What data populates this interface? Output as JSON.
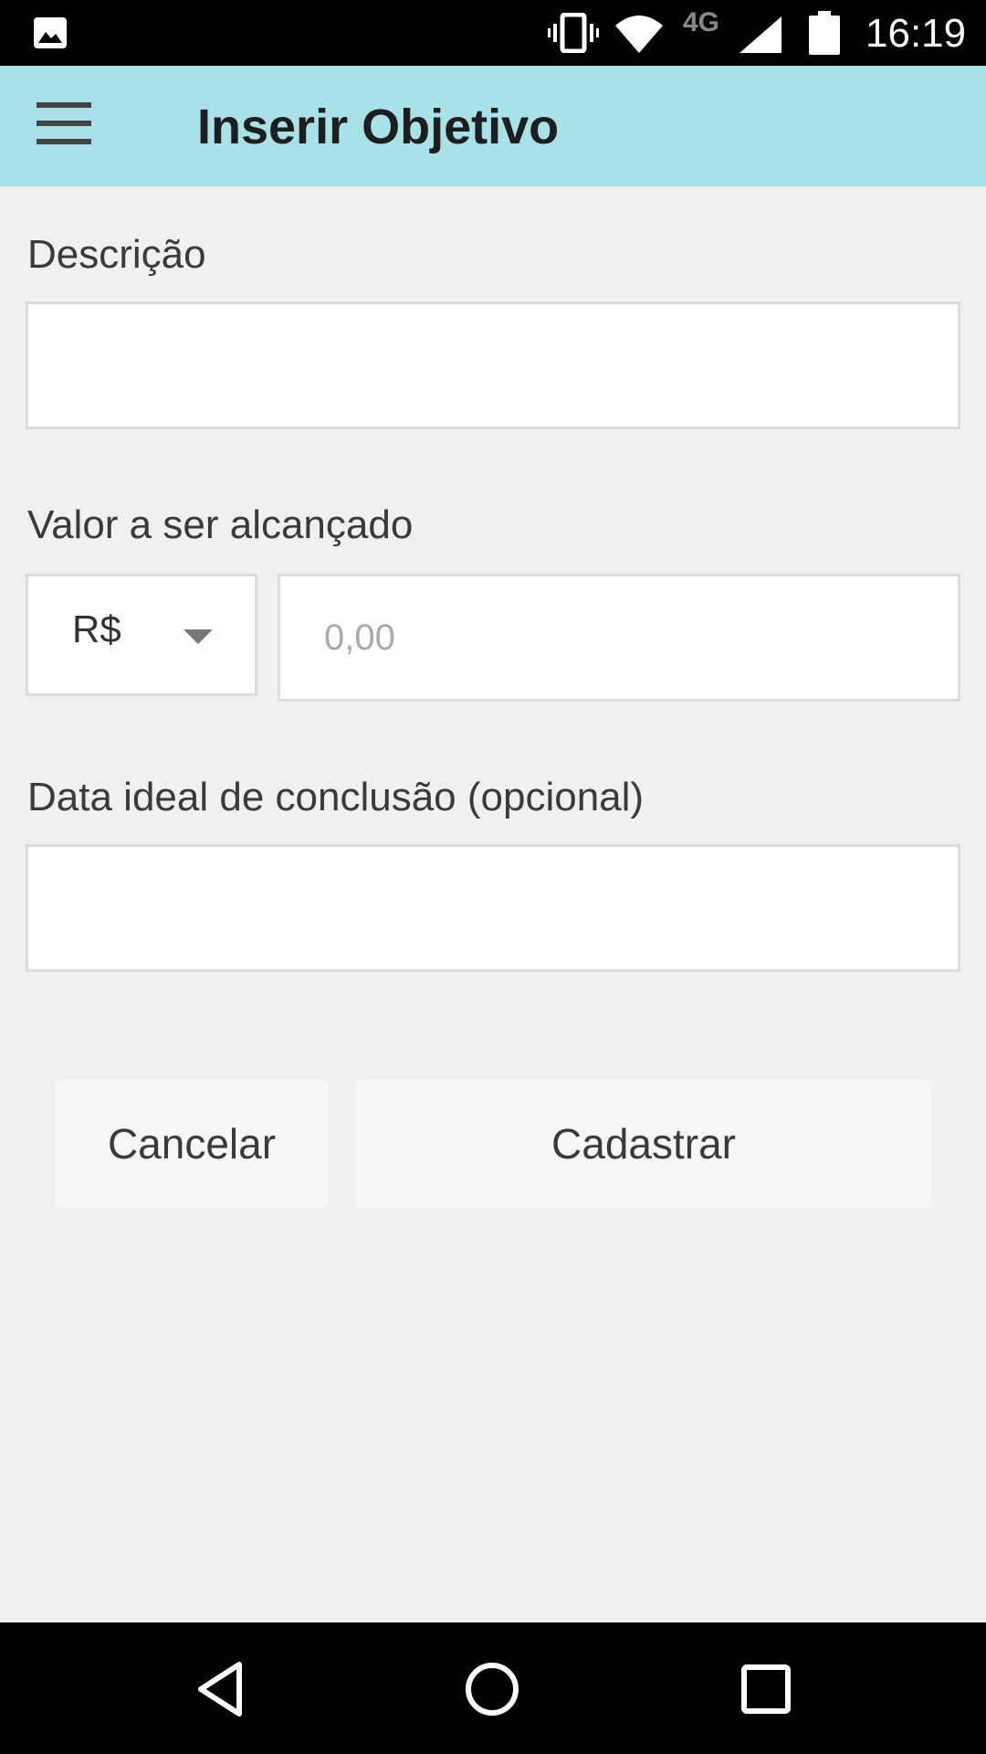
{
  "status_bar": {
    "network_type": "4G",
    "time": "16:19",
    "icons": [
      "image-icon",
      "vibrate-icon",
      "wifi-icon",
      "signal-icon",
      "battery-icon"
    ]
  },
  "toolbar": {
    "title": "Inserir Objetivo",
    "menu_icon": "hamburger-menu-icon",
    "background_color": "#a6e2e8"
  },
  "form": {
    "description_label": "Descrição",
    "description_value": "",
    "amount_label": "Valor a ser alcançado",
    "currency_selected": "R$",
    "amount_placeholder": "0,00",
    "date_label": "Data ideal de conclusão (opcional)",
    "date_value": ""
  },
  "actions": {
    "cancel_label": "Cancelar",
    "submit_label": "Cadastrar"
  },
  "nav_bar": {
    "icons": [
      "back-icon",
      "home-icon",
      "recents-icon"
    ]
  }
}
